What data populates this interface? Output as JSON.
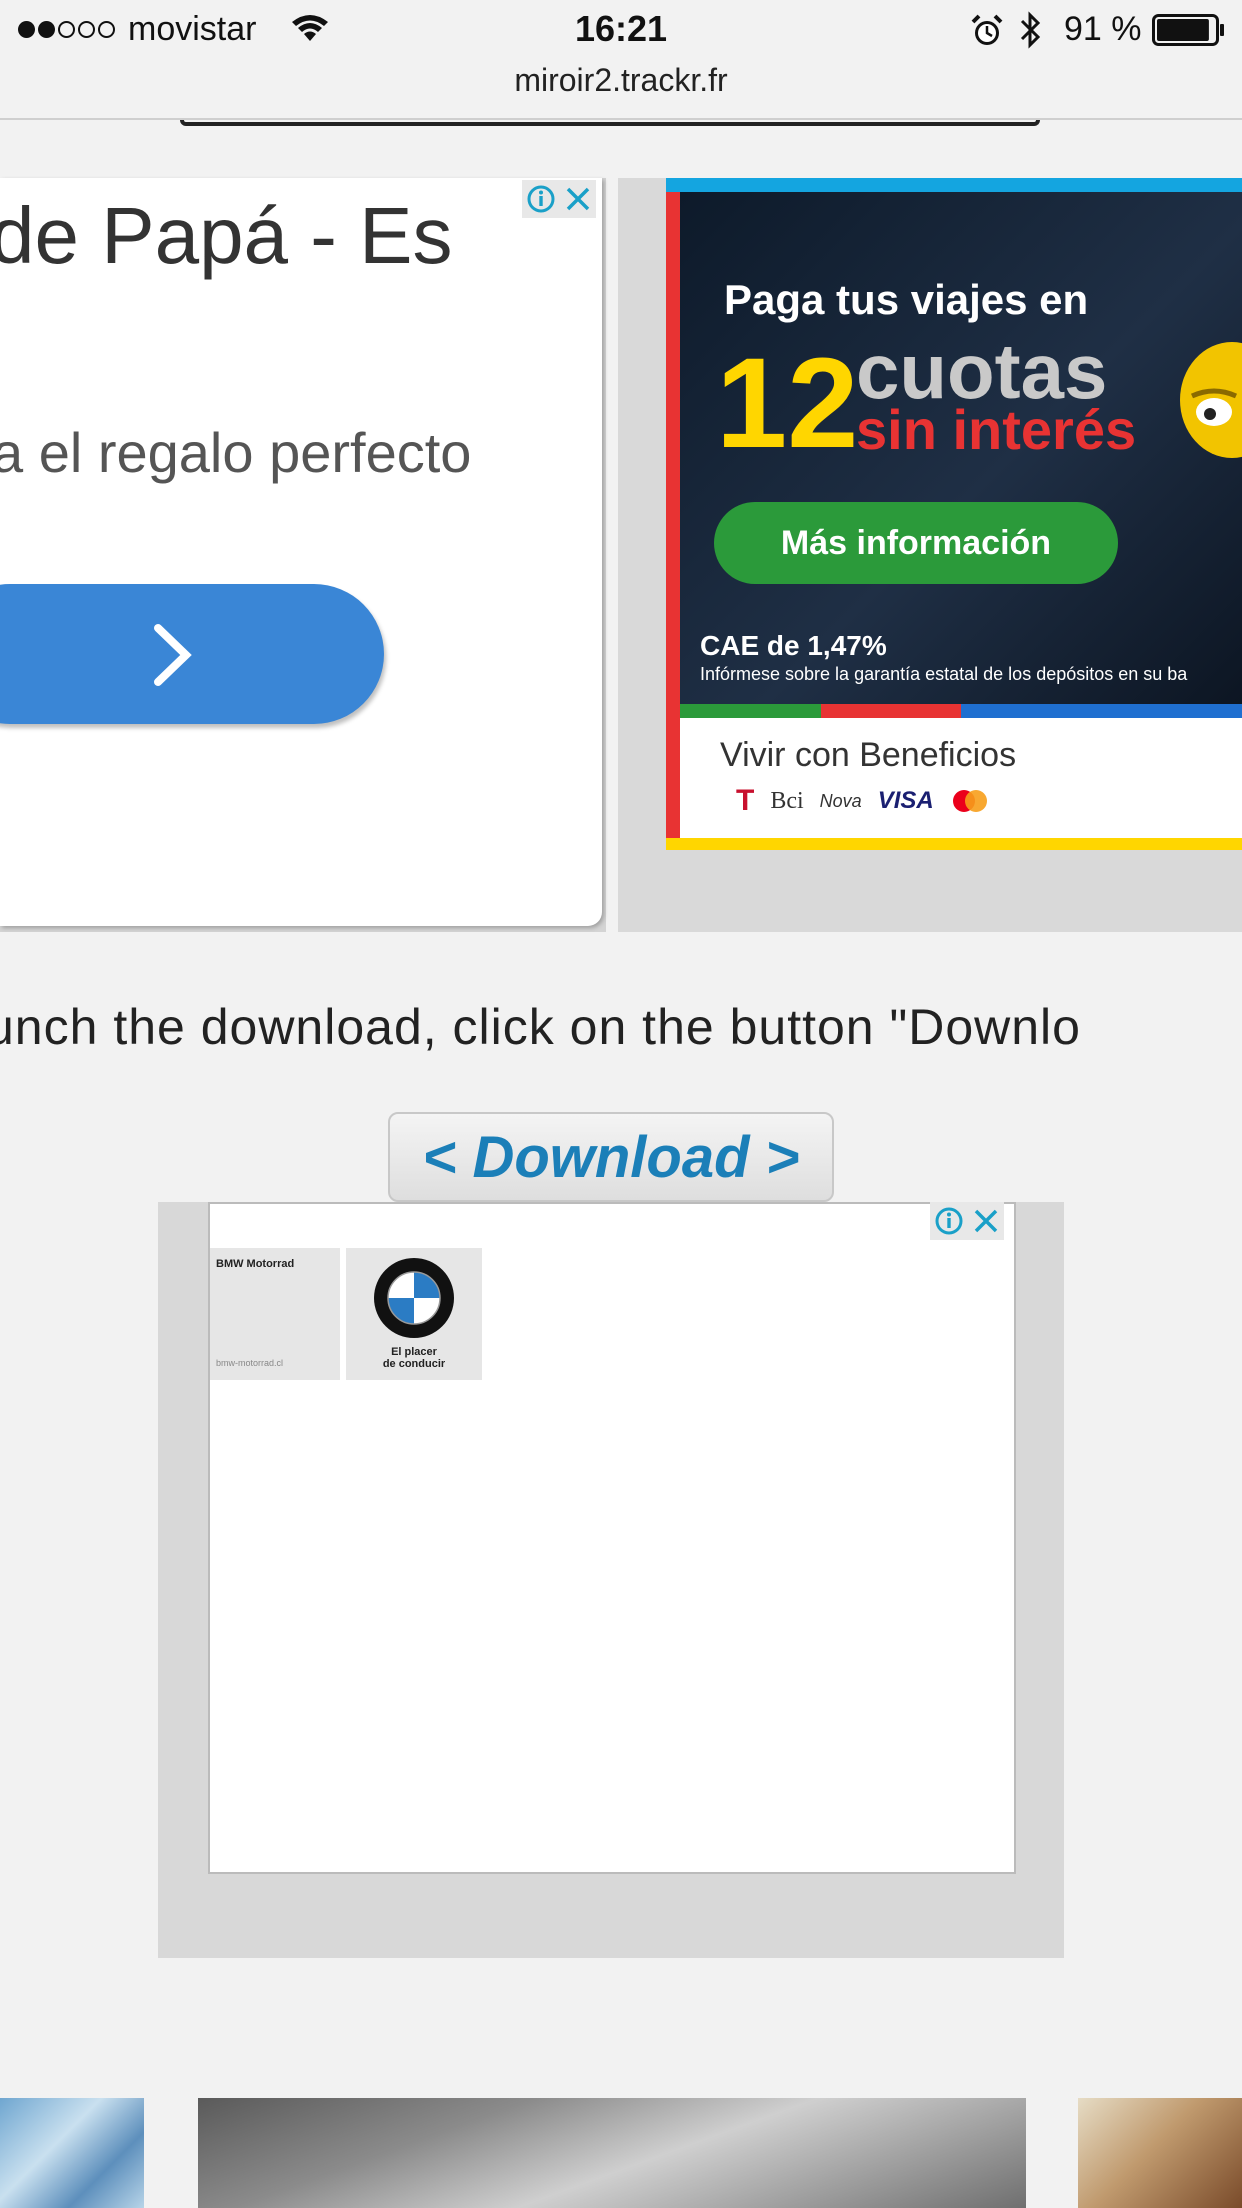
{
  "status_bar": {
    "signal_dots_filled": 2,
    "signal_dots_total": 5,
    "carrier": "movistar",
    "time": "16:21",
    "battery_percent": "91 %",
    "battery_level": 0.91
  },
  "browser": {
    "url": "miroir2.trackr.fr"
  },
  "ad_left": {
    "title": "de Papá - Es",
    "subtitle": "a el regalo perfecto"
  },
  "ad_right": {
    "line1": "Paga tus viajes en",
    "big_number": "12",
    "cuotas": "cuotas",
    "sin_interes": "sin interés",
    "button_label": "Más información",
    "cae": "CAE de 1,47%",
    "fine_print": "Infórmese sobre la garantía estatal de los depósitos en su ba",
    "benefits": "Vivir con Beneficios",
    "logos": [
      "T",
      "Bci",
      "Nova",
      "VISA"
    ],
    "stripe_colors": [
      "#2b9a3a",
      "#e83333",
      "#1f6fd0",
      "#1f6fd0"
    ]
  },
  "instructions": "unch the download, click on the button \"Downlo",
  "download_button": {
    "label": "< Download >"
  },
  "ad_bottom": {
    "tile_title": "BMW Motorrad",
    "tile_url": "bmw-motorrad.cl",
    "slogan_line1": "El placer",
    "slogan_line2": "de conducir"
  },
  "colors": {
    "page_bg": "#f2f2f2",
    "download_text": "#1b7fb8",
    "cta_blue": "#3a86d6",
    "adchoice_blue": "#1aa0c8"
  }
}
